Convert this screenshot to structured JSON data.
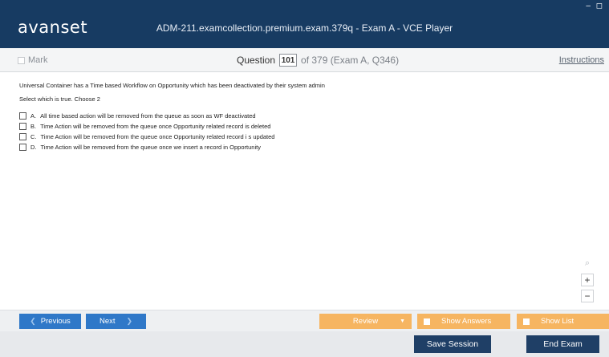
{
  "app": {
    "logo": "avanset",
    "window_title": "ADM-211.examcollection.premium.exam.379q - Exam A - VCE Player",
    "window_controls": "– ◻"
  },
  "header": {
    "mark_label": "Mark",
    "question_label": "Question",
    "question_number": "101",
    "question_total": "of 379 (Exam A, Q346)",
    "instructions_label": "Instructions"
  },
  "question": {
    "text": "Universal Container has a Time based Workflow on Opportunity which has been deactivated by their system admin",
    "instruction": "Select which is true. Choose 2",
    "options": [
      {
        "letter": "A.",
        "text": "All time based action will be removed from the queue as soon as WF deactivated"
      },
      {
        "letter": "B.",
        "text": "Time Action will be removed from the queue once Opportunity related record is deleted"
      },
      {
        "letter": "C.",
        "text": "Time Action will be removed from the queue once Opportunity related record i s updated"
      },
      {
        "letter": "D.",
        "text": "Time Action will be removed from the queue once we insert a record in Opportunity"
      }
    ]
  },
  "zoom": {
    "search_icon": "⌕",
    "plus": "+",
    "minus": "−"
  },
  "toolbar": {
    "previous_label": "Previous",
    "next_label": "Next",
    "review_label": "Review",
    "show_answers_label": "Show Answers",
    "show_list_label": "Show List",
    "arrow_left": "❮",
    "arrow_right": "❯",
    "caret": "▼"
  },
  "session": {
    "save_label": "Save Session",
    "end_label": "End Exam"
  },
  "colors": {
    "titlebar": "#173b62",
    "primary_button": "#2f78c8",
    "orange_button": "#f6b561",
    "dark_button": "#1f3f66"
  }
}
